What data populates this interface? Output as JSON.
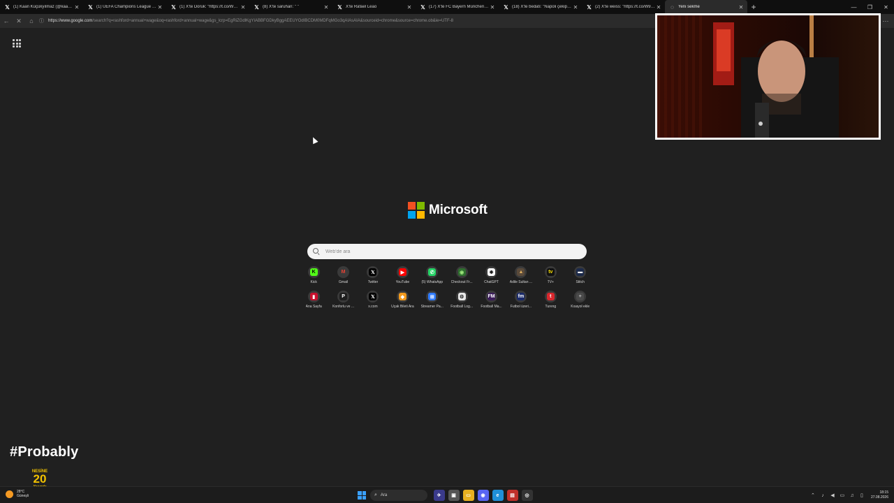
{
  "tabs": [
    {
      "icon": "x-icon",
      "title": "(1) Kaan Küçükyılmaz (@kaanckcky"
    },
    {
      "icon": "x-icon",
      "title": "(1) UEFA Champions League (@Ch"
    },
    {
      "icon": "x-icon",
      "title": "(1) X'te Doruk: \"https://t.co/W8YA"
    },
    {
      "icon": "x-icon",
      "title": "(8) X'te saruhan: \" \""
    },
    {
      "icon": "x-icon",
      "title": "X'te Rafael Leão"
    },
    {
      "icon": "x-icon",
      "title": "(17) X'te FC Bayern München: \"Ne"
    },
    {
      "icon": "x-icon",
      "title": "(18) X'te bedatı: \"Napoli çekip ind"
    },
    {
      "icon": "x-icon",
      "title": "(2) X'te weiss: \"https://t.co/W9ypI"
    },
    {
      "icon": "loading-icon",
      "title": "Yeni sekme"
    }
  ],
  "address": {
    "host": "https://www.google.com",
    "path": "/search?q=rashford+annual+wage&oq=rashford+annual+wage&gs_lcrp=EgRiZGdlKgYIABBFGDkyBggAEEUYOdIBCDM0MDFqMGo3qAIAsAIA&sourceid=chrome&source=chrome.ob&ie=UTF-8"
  },
  "brand": {
    "name": "Microsoft",
    "colors": [
      "#f25022",
      "#7fba00",
      "#00a4ef",
      "#ffb900"
    ]
  },
  "search": {
    "placeholder": "Web'de ara"
  },
  "shortcuts": [
    {
      "label": "Kick",
      "glyph": "K",
      "bg": "#53fc18",
      "fg": "#000000",
      "icon": "kick-icon"
    },
    {
      "label": "Gmail",
      "glyph": "M",
      "bg": "#3a3a3a",
      "fg": "#ea4335",
      "icon": "gmail-icon"
    },
    {
      "label": "Twitter",
      "glyph": "𝕏",
      "bg": "#000000",
      "fg": "#ffffff",
      "icon": "x-icon"
    },
    {
      "label": "YouTube",
      "glyph": "▶",
      "bg": "#ff0000",
      "fg": "#ffffff",
      "icon": "youtube-icon"
    },
    {
      "label": "(5) WhatsApp",
      "glyph": "✆",
      "bg": "#25d366",
      "fg": "#ffffff",
      "icon": "whatsapp-icon"
    },
    {
      "label": "Checkout Fr...",
      "glyph": "◉",
      "bg": "#2f6f2f",
      "fg": "#9be37a",
      "icon": "checkout-icon"
    },
    {
      "label": "ChatGPT",
      "glyph": "❋",
      "bg": "#ffffff",
      "fg": "#111111",
      "icon": "chatgpt-icon"
    },
    {
      "label": "Adile Sultan ...",
      "glyph": "▲",
      "bg": "#5a4a3a",
      "fg": "#e0b060",
      "icon": "adile-sultan-icon"
    },
    {
      "label": "TV+",
      "glyph": "tv",
      "bg": "#111111",
      "fg": "#ffe600",
      "icon": "tv-plus-icon"
    },
    {
      "label": "Stitch",
      "glyph": "▬",
      "bg": "#1c2a4a",
      "fg": "#ffffff",
      "icon": "stitch-icon"
    },
    {
      "label": "Ana Sayfa",
      "glyph": "▮",
      "bg": "#c8102e",
      "fg": "#ffffff",
      "icon": "netflix-icon"
    },
    {
      "label": "Konforlu ve ...",
      "glyph": "P",
      "bg": "#1e1e1e",
      "fg": "#ffffff",
      "icon": "konforlu-icon"
    },
    {
      "label": "x.com",
      "glyph": "𝕏",
      "bg": "#000000",
      "fg": "#ffffff",
      "icon": "x-icon"
    },
    {
      "label": "Uçak Bileti Ara",
      "glyph": "◆",
      "bg": "#f39a1d",
      "fg": "#ffffff",
      "icon": "flight-icon"
    },
    {
      "label": "Streamer Pa...",
      "glyph": "⊞",
      "bg": "#2f7bff",
      "fg": "#ffffff",
      "icon": "streamer-panel-icon"
    },
    {
      "label": "Football Log...",
      "glyph": "⚙",
      "bg": "#e8e8e8",
      "fg": "#222222",
      "icon": "football-log-icon"
    },
    {
      "label": "Football Ma...",
      "glyph": "FM",
      "bg": "#3b1c5a",
      "fg": "#ffffff",
      "icon": "football-manager-icon"
    },
    {
      "label": "Futbol üzeri...",
      "glyph": "fm",
      "bg": "#1a2a6a",
      "fg": "#ffffff",
      "icon": "futbol-icon"
    },
    {
      "label": "Tureng",
      "glyph": "t",
      "bg": "#d8272d",
      "fg": "#ffffff",
      "icon": "tureng-icon"
    },
    {
      "label": "Kısayol ekle",
      "glyph": "+",
      "bg": "#4a4a4a",
      "fg": "#bbbbbb",
      "icon": "add-shortcut-icon"
    }
  ],
  "overlay": {
    "hashtag": "#Probably",
    "sponsor_top": "NESİNE",
    "sponsor_mid": "20",
    "sponsor_bottom": "Yaşında"
  },
  "taskbar": {
    "weather_temp": "28°C",
    "weather_desc": "Güneşli",
    "search_label": "Ara",
    "time": "18:15",
    "date": "27.08.2026"
  }
}
